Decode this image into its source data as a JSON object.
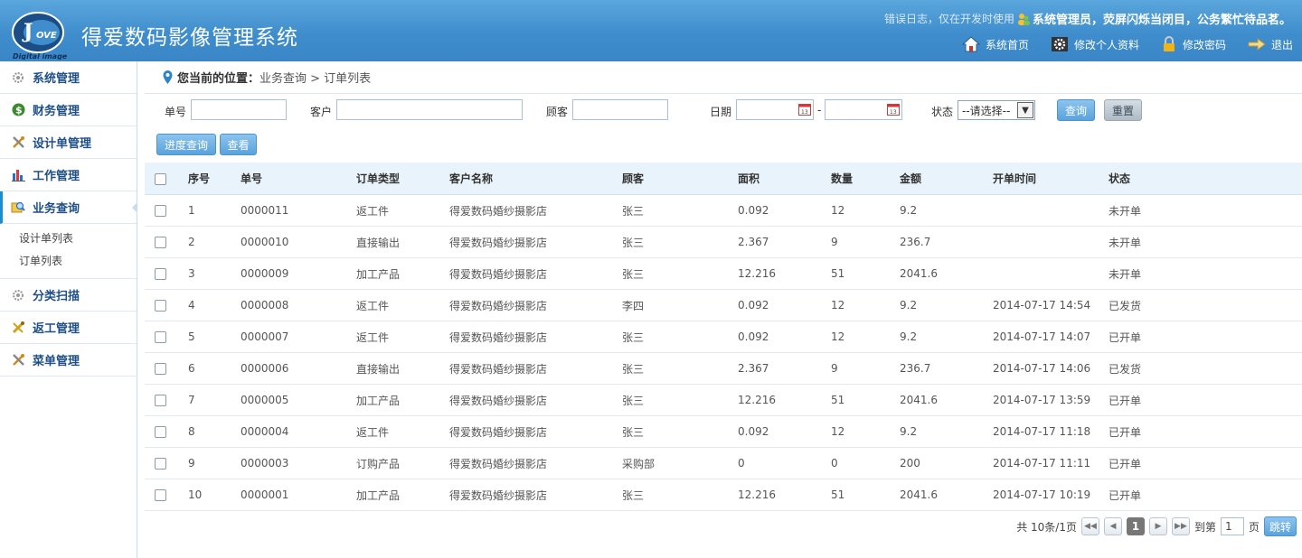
{
  "app": {
    "title": "得爱数码影像管理系统",
    "logo_subtitle": "Digital image",
    "logo_text": "LOVE"
  },
  "header": {
    "message_prefix": "错误日志，仅在开发时使用",
    "greeting": "系统管理员，荧屏闪烁当闭目，公务繁忙待品茗。",
    "nav": [
      {
        "label": "系统首页",
        "icon": "home-icon"
      },
      {
        "label": "修改个人资料",
        "icon": "gear-icon"
      },
      {
        "label": "修改密码",
        "icon": "lock-icon"
      },
      {
        "label": "退出",
        "icon": "arrow-right-icon"
      }
    ]
  },
  "sidebar": {
    "items": [
      {
        "label": "系统管理",
        "icon": "gear-icon"
      },
      {
        "label": "财务管理",
        "icon": "dollar-icon"
      },
      {
        "label": "设计单管理",
        "icon": "tools-icon"
      },
      {
        "label": "工作管理",
        "icon": "bar-chart-icon"
      },
      {
        "label": "业务查询",
        "icon": "search-document-icon",
        "active": true
      },
      {
        "label": "分类扫描",
        "icon": "gear-icon"
      },
      {
        "label": "返工管理",
        "icon": "wrench-icon"
      },
      {
        "label": "菜单管理",
        "icon": "tools-icon"
      }
    ],
    "subitems": [
      "设计单列表",
      "订单列表"
    ]
  },
  "breadcrumb": {
    "label": "您当前的位置：",
    "path": "业务查询 > 订单列表"
  },
  "filters": {
    "order_no_label": "单号",
    "order_no_value": "",
    "customer_label": "客户",
    "customer_value": "",
    "client_label": "顾客",
    "client_value": "",
    "date_label": "日期",
    "date_from": "",
    "date_sep": "-",
    "date_to": "",
    "status_label": "状态",
    "status_value": "--请选择--",
    "query_label": "查询",
    "reset_label": "重置",
    "progress_label": "进度查询",
    "view_label": "查看"
  },
  "table": {
    "columns": [
      "序号",
      "单号",
      "订单类型",
      "客户名称",
      "顾客",
      "面积",
      "数量",
      "金额",
      "开单时间",
      "状态"
    ],
    "rows": [
      [
        "1",
        "0000011",
        "返工件",
        "得爱数码婚纱摄影店",
        "张三",
        "0.092",
        "12",
        "9.2",
        "",
        "未开单"
      ],
      [
        "2",
        "0000010",
        "直接输出",
        "得爱数码婚纱摄影店",
        "张三",
        "2.367",
        "9",
        "236.7",
        "",
        "未开单"
      ],
      [
        "3",
        "0000009",
        "加工产品",
        "得爱数码婚纱摄影店",
        "张三",
        "12.216",
        "51",
        "2041.6",
        "",
        "未开单"
      ],
      [
        "4",
        "0000008",
        "返工件",
        "得爱数码婚纱摄影店",
        "李四",
        "0.092",
        "12",
        "9.2",
        "2014-07-17 14:54",
        "已发货"
      ],
      [
        "5",
        "0000007",
        "返工件",
        "得爱数码婚纱摄影店",
        "张三",
        "0.092",
        "12",
        "9.2",
        "2014-07-17 14:07",
        "已开单"
      ],
      [
        "6",
        "0000006",
        "直接输出",
        "得爱数码婚纱摄影店",
        "张三",
        "2.367",
        "9",
        "236.7",
        "2014-07-17 14:06",
        "已发货"
      ],
      [
        "7",
        "0000005",
        "加工产品",
        "得爱数码婚纱摄影店",
        "张三",
        "12.216",
        "51",
        "2041.6",
        "2014-07-17 13:59",
        "已开单"
      ],
      [
        "8",
        "0000004",
        "返工件",
        "得爱数码婚纱摄影店",
        "张三",
        "0.092",
        "12",
        "9.2",
        "2014-07-17 11:18",
        "已开单"
      ],
      [
        "9",
        "0000003",
        "订购产品",
        "得爱数码婚纱摄影店",
        "采购部",
        "0",
        "0",
        "200",
        "2014-07-17 11:11",
        "已开单"
      ],
      [
        "10",
        "0000001",
        "加工产品",
        "得爱数码婚纱摄影店",
        "张三",
        "12.216",
        "51",
        "2041.6",
        "2014-07-17 10:19",
        "已开单"
      ]
    ]
  },
  "pager": {
    "summary": "共 10条/1页",
    "current": "1",
    "goto_label": "到第",
    "goto_value": "1",
    "page_suffix": "页",
    "jump_label": "跳转"
  },
  "colors": {
    "header_blue": "#3f8dcc",
    "sidebar_text": "#1e4f86",
    "table_head_bg": "#e9f3fb"
  }
}
